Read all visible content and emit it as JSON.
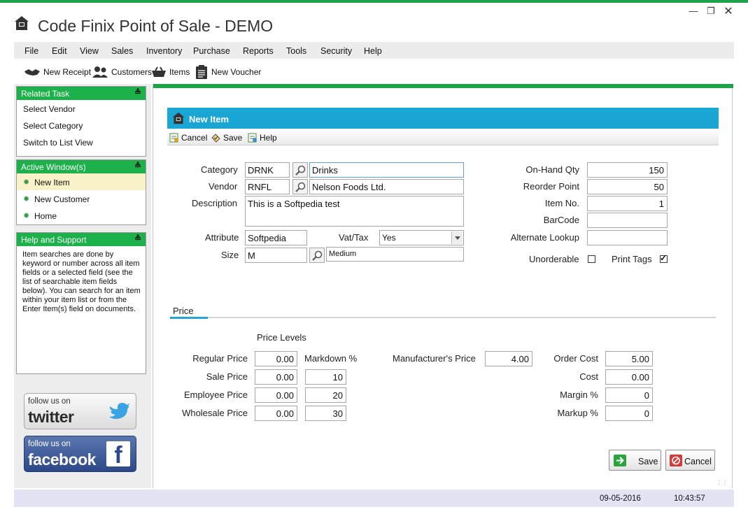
{
  "app": {
    "title": "Code Finix Point of Sale - DEMO",
    "accent": "#1ea34a",
    "header_blue": "#1aa7d6"
  },
  "window_controls": [
    "minimize",
    "restore",
    "close"
  ],
  "menu": [
    "File",
    "Edit",
    "View",
    "Sales",
    "Inventory",
    "Purchase",
    "Reports",
    "Tools",
    "Security",
    "Help"
  ],
  "toolbar": {
    "new_receipt": "New Receipt",
    "customers": "Customers",
    "items": "Items",
    "new_voucher": "New Voucher"
  },
  "sidebar": {
    "related_task": {
      "title": "Related Task",
      "items": [
        "Select Vendor",
        "Select Category",
        "Switch to List View"
      ]
    },
    "active_windows": {
      "title": "Active Window(s)",
      "items": [
        "New Item",
        "New Customer",
        "Home"
      ],
      "selected": "New Item"
    },
    "help": {
      "title": "Help and Support",
      "text": "Item searches are done by keyword or number across all item fields or a selected field (see the list of searchable item fields below). You can search for an item within your item list or from the Enter Item(s) field on documents."
    },
    "twitter": {
      "small": "follow us on",
      "big": "twitter"
    },
    "facebook": {
      "small": "follow us on",
      "big": "facebook"
    }
  },
  "form": {
    "title": "New Item",
    "toolbar": {
      "cancel": "Cancel",
      "save": "Save",
      "help": "Help"
    },
    "labels": {
      "category": "Category",
      "vendor": "Vendor",
      "description": "Description",
      "attribute": "Attribute",
      "vat_tax": "Vat/Tax",
      "size": "Size",
      "on_hand_qty": "On-Hand Qty",
      "reorder_point": "Reorder Point",
      "item_no": "Item No.",
      "barcode": "BarCode",
      "alternate_lookup": "Alternate Lookup",
      "unorderable": "Unorderable",
      "print_tags": "Print Tags"
    },
    "values": {
      "category_code": "DRNK",
      "category_name": "Drinks",
      "vendor_code": "RNFL",
      "vendor_name": "Nelson Foods Ltd.",
      "description": "This is a Softpedia test",
      "attribute": "Softpedia",
      "vat_tax": "Yes",
      "size_code": "M",
      "size_name": "Medium",
      "on_hand_qty": "150",
      "reorder_point": "50",
      "item_no": "1",
      "barcode": "",
      "alternate_lookup": "",
      "unorderable": false,
      "print_tags": true
    }
  },
  "price": {
    "tab": "Price",
    "levels_title": "Price Levels",
    "markdown_label": "Markdown %",
    "rows": [
      {
        "label": "Regular Price",
        "value": "0.00",
        "markdown": ""
      },
      {
        "label": "Sale Price",
        "value": "0.00",
        "markdown": "10"
      },
      {
        "label": "Employee Price",
        "value": "0.00",
        "markdown": "20"
      },
      {
        "label": "Wholesale Price",
        "value": "0.00",
        "markdown": "30"
      }
    ],
    "manufacturer_label": "Manufacturer's Price",
    "manufacturer_value": "4.00",
    "costs": [
      {
        "label": "Order Cost",
        "value": "5.00"
      },
      {
        "label": "Cost",
        "value": "0.00"
      },
      {
        "label": "Margin %",
        "value": "0"
      },
      {
        "label": "Markup %",
        "value": "0"
      }
    ]
  },
  "buttons": {
    "save": "Save",
    "cancel": "Cancel"
  },
  "status": {
    "date": "09-05-2016",
    "time": "10:43:57"
  }
}
